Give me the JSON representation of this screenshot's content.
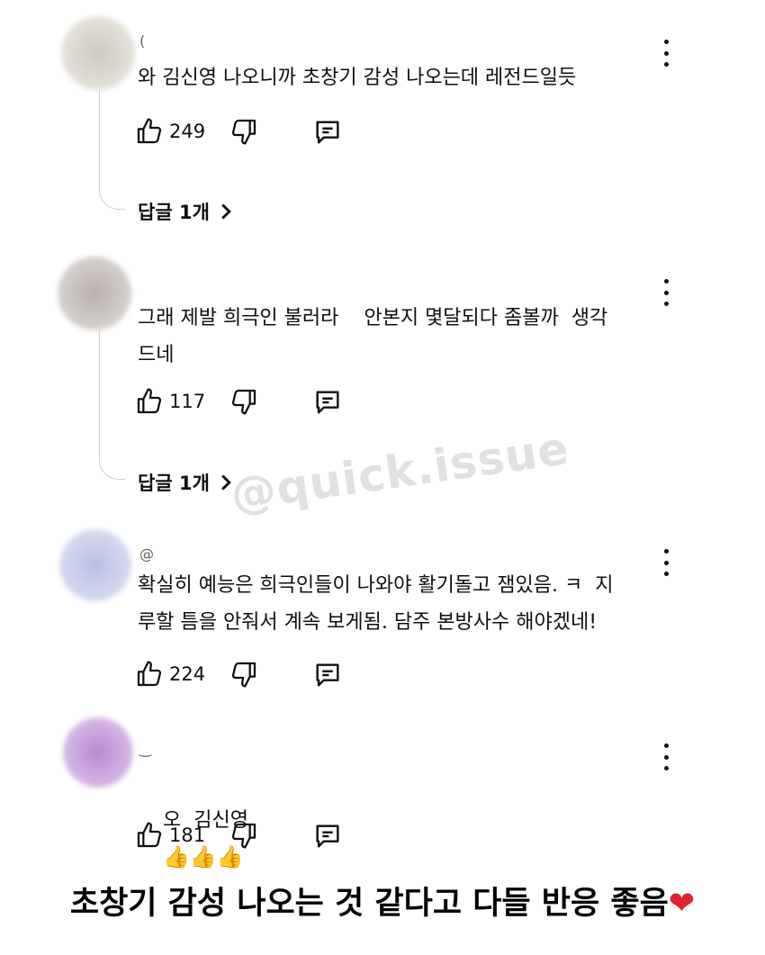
{
  "comments": [
    {
      "handle": "(",
      "text": "와 김신영 나오니까 초창기 감성 나오는데 레전드일듯",
      "likes": "249",
      "replies_label": "답글 1개",
      "avatar_color": "#d9d5cc"
    },
    {
      "handle": "",
      "text": "그래 제발 희극인 불러라    안본지 몇달되다 좀볼까  생각\n드네",
      "likes": "117",
      "replies_label": "답글 1개",
      "avatar_color": "#c9c2bf"
    },
    {
      "handle": "@",
      "text": "확실히 예능은 희극인들이 나와야 활기돌고 잼있음. ㅋ  지\n루할 틈을 안줘서 계속 보게됨. 담주 본방사수 해야겠네!",
      "likes": "224",
      "avatar_color": "#c7cbe8"
    },
    {
      "handle": "‿",
      "text": "오  김신영",
      "emoji": "👍👍👍",
      "likes": "181",
      "avatar_color": "#c79ad9"
    }
  ],
  "watermark": "@quick.issue",
  "caption": "초창기 감성 나오는 것 같다고 다들 반응 좋음",
  "caption_heart": "❤",
  "icons": {
    "like": "thumbs-up-icon",
    "dislike": "thumbs-down-icon",
    "reply": "comment-icon",
    "more": "more-vert-icon",
    "chevron": "chevron-right-icon"
  }
}
